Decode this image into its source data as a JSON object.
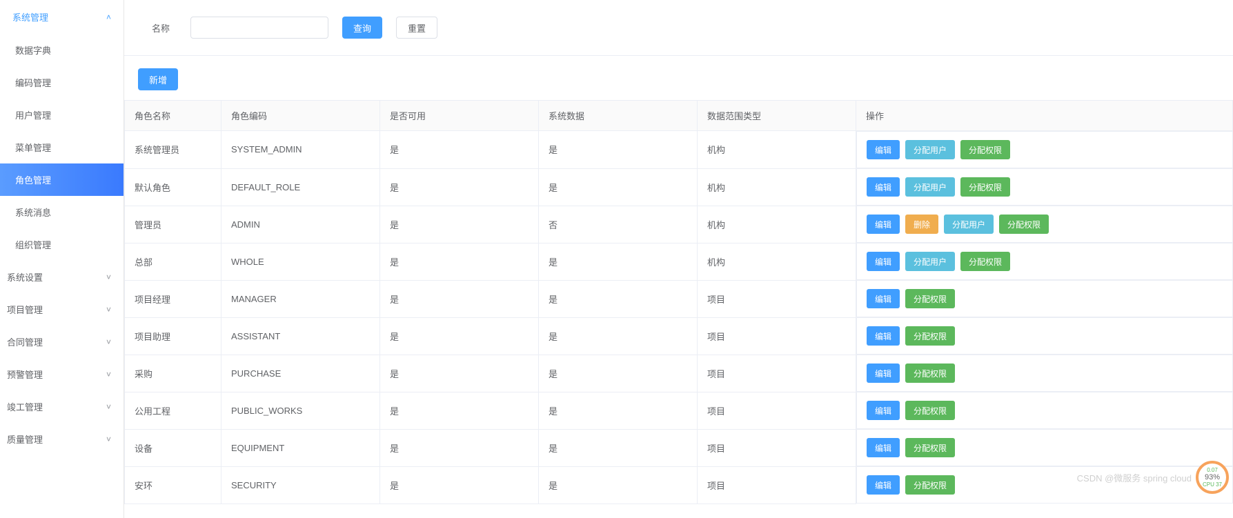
{
  "sidebar": {
    "expanded_group": "系统管理",
    "items": [
      {
        "label": "数据字典",
        "active": false
      },
      {
        "label": "编码管理",
        "active": false
      },
      {
        "label": "用户管理",
        "active": false
      },
      {
        "label": "菜单管理",
        "active": false
      },
      {
        "label": "角色管理",
        "active": true
      },
      {
        "label": "系统消息",
        "active": false
      },
      {
        "label": "组织管理",
        "active": false
      }
    ],
    "groups": [
      {
        "label": "系统设置"
      },
      {
        "label": "项目管理"
      },
      {
        "label": "合同管理"
      },
      {
        "label": "预警管理"
      },
      {
        "label": "竣工管理"
      },
      {
        "label": "质量管理"
      }
    ]
  },
  "search": {
    "label": "名称",
    "placeholder": "",
    "value": "",
    "query_btn": "查询",
    "reset_btn": "重置"
  },
  "toolbar": {
    "add_btn": "新增"
  },
  "table": {
    "headers": {
      "name": "角色名称",
      "code": "角色编码",
      "enabled": "是否可用",
      "sysdata": "系统数据",
      "scope": "数据范围类型",
      "actions": "操作"
    },
    "rows": [
      {
        "name": "系统管理员",
        "code": "SYSTEM_ADMIN",
        "enabled": "是",
        "sysdata": "是",
        "scope": "机构",
        "actions": [
          "edit",
          "assign_user",
          "assign_perm"
        ]
      },
      {
        "name": "默认角色",
        "code": "DEFAULT_ROLE",
        "enabled": "是",
        "sysdata": "是",
        "scope": "机构",
        "actions": [
          "edit",
          "assign_user",
          "assign_perm"
        ]
      },
      {
        "name": "管理员",
        "code": "ADMIN",
        "enabled": "是",
        "sysdata": "否",
        "scope": "机构",
        "actions": [
          "edit",
          "delete",
          "assign_user",
          "assign_perm"
        ]
      },
      {
        "name": "总部",
        "code": "WHOLE",
        "enabled": "是",
        "sysdata": "是",
        "scope": "机构",
        "actions": [
          "edit",
          "assign_user",
          "assign_perm"
        ]
      },
      {
        "name": "项目经理",
        "code": "MANAGER",
        "enabled": "是",
        "sysdata": "是",
        "scope": "项目",
        "actions": [
          "edit",
          "assign_perm"
        ]
      },
      {
        "name": "项目助理",
        "code": "ASSISTANT",
        "enabled": "是",
        "sysdata": "是",
        "scope": "项目",
        "actions": [
          "edit",
          "assign_perm"
        ]
      },
      {
        "name": "采购",
        "code": "PURCHASE",
        "enabled": "是",
        "sysdata": "是",
        "scope": "项目",
        "actions": [
          "edit",
          "assign_perm"
        ]
      },
      {
        "name": "公用工程",
        "code": "PUBLIC_WORKS",
        "enabled": "是",
        "sysdata": "是",
        "scope": "项目",
        "actions": [
          "edit",
          "assign_perm"
        ]
      },
      {
        "name": "设备",
        "code": "EQUIPMENT",
        "enabled": "是",
        "sysdata": "是",
        "scope": "项目",
        "actions": [
          "edit",
          "assign_perm"
        ]
      },
      {
        "name": "安环",
        "code": "SECURITY",
        "enabled": "是",
        "sysdata": "是",
        "scope": "项目",
        "actions": [
          "edit",
          "assign_perm"
        ]
      }
    ]
  },
  "action_labels": {
    "edit": "编辑",
    "delete": "删除",
    "assign_user": "分配用户",
    "assign_perm": "分配权限"
  },
  "watermark": "CSDN @微服务 spring cloud",
  "cpu": {
    "pct": "93%",
    "label": "CPU 37",
    "load": "0.07"
  }
}
